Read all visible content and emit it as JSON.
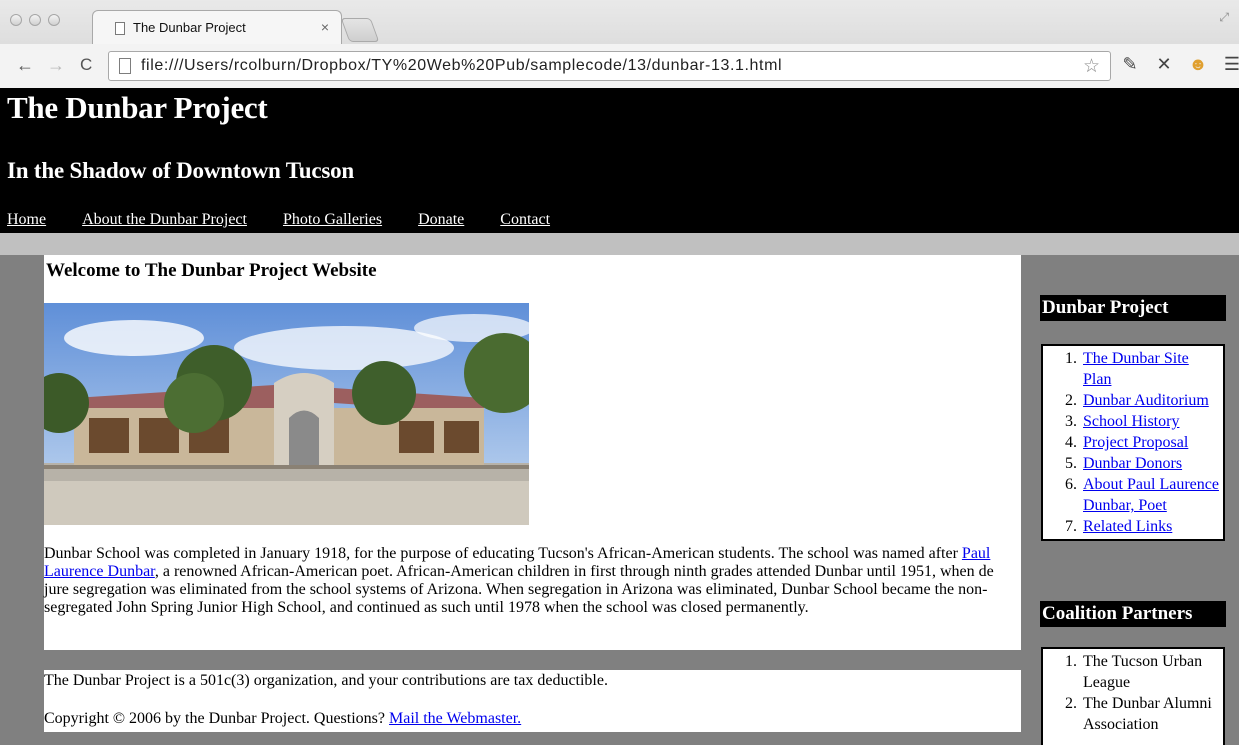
{
  "browser": {
    "tab_title": "The Dunbar Project",
    "tab_close": "×",
    "url": "file:///Users/rcolburn/Dropbox/TY%20Web%20Pub/samplecode/13/dunbar-13.1.html",
    "icons": [
      "back-arrow-icon",
      "forward-arrow-icon",
      "reload-icon",
      "page-icon",
      "bookmark-star-icon",
      "wrench-icon",
      "tool-icon",
      "extension-icon",
      "menu-icon"
    ]
  },
  "header": {
    "title": "The Dunbar Project",
    "subtitle": "In the Shadow of Downtown Tucson",
    "nav": [
      "Home",
      "About the Dunbar Project",
      "Photo Galleries",
      "Donate",
      "Contact"
    ]
  },
  "main": {
    "heading": "Welcome to The Dunbar Project Website",
    "intro_before_link": "Dunbar School was completed in January 1918, for the purpose of educating Tucson's African-American students. The school was named after ",
    "intro_link": "Paul Laurence Dunbar",
    "intro_after_link": ", a renowned African-American poet. African-American children in first through ninth grades attended Dunbar until 1951, when de jure segregation was eliminated from the school systems of Arizona. When segregation in Arizona was eliminated, Dunbar School became the non-segregated John Spring Junior High School, and continued as such until 1978 when the school was closed permanently."
  },
  "footer": {
    "note": "The Dunbar Project is a 501c(3) organization, and your contributions are tax deductible.",
    "copyright_text": "Copyright © 2006 by the Dunbar Project. Questions? ",
    "mail_link": "Mail the Webmaster."
  },
  "sidebar": {
    "project_heading": "Dunbar Project",
    "project_links": [
      "The Dunbar Site Plan",
      "Dunbar Auditorium",
      "School History",
      "Project Proposal",
      "Dunbar Donors",
      "About Paul Laurence Dunbar, Poet",
      "Related Links"
    ],
    "partners_heading": "Coalition Partners",
    "partners": [
      "The Tucson Urban League",
      "The Dunbar Alumni Association"
    ]
  }
}
